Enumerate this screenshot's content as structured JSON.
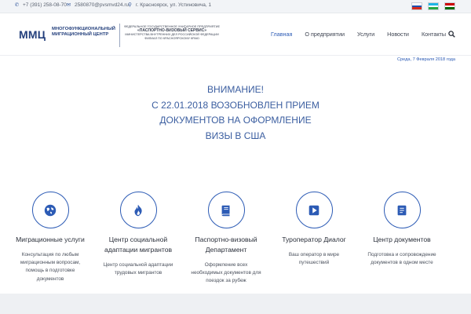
{
  "topbar": {
    "phone": "+7 (391) 258-08-70",
    "email": "2580870@pvsmvd24.ru",
    "address": "г. Красноярск, ул. Устиновича, 1",
    "phone_icon": "phone-icon",
    "email_icon": "envelope-icon",
    "address_icon": "map-pin-icon",
    "flags": [
      {
        "name": "flag-ru",
        "colors": [
          "#ffffff",
          "#1f4fb0",
          "#d52b1e"
        ]
      },
      {
        "name": "flag-uz",
        "colors": [
          "#1eb5e6",
          "#ffffff",
          "#27a844"
        ]
      },
      {
        "name": "flag-tj",
        "colors": [
          "#cc0000",
          "#ffffff",
          "#006600"
        ]
      }
    ]
  },
  "header": {
    "logo_main": "ММЦ",
    "logo_sub": "МНОГОФУНКЦИОНАЛЬНЫЙ МИГРАЦИОННЫЙ ЦЕНТР",
    "org_line1": "ФЕДЕРАЛЬНОЕ ГОСУДАРСТВЕННОЕ УНИТАРНОЕ ПРЕДПРИЯТИЕ",
    "org_line2": "«ПАСПОРТНО-ВИЗОВЫЙ СЕРВИС»",
    "org_line3": "МИНИСТЕРСТВА ВНУТРЕННИХ ДЕЛ РОССИЙСКОЙ ФЕДЕРАЦИИ",
    "org_line4": "ФИЛИАЛ ПО КРАСНОЯРСКОМУ КРАЮ",
    "nav": [
      "Главная",
      "О предприятии",
      "Услуги",
      "Новости",
      "Контакты"
    ],
    "search_icon": "search-icon",
    "date": "Среда, 7 Февраля 2018 года"
  },
  "notice": {
    "line1": "ВНИМАНИЕ!",
    "line2": "С 22.01.2018 ВОЗОБНОВЛЕН ПРИЕМ",
    "line3": "ДОКУМЕНТОВ НА ОФОРМЛЕНИЕ",
    "line4": "ВИЗЫ В США"
  },
  "services": [
    {
      "icon": "globe-icon",
      "title": "Миграционные услуги",
      "desc": "Консультация по любым миграционным вопросам, помощь в подготовке документов"
    },
    {
      "icon": "fire-icon",
      "title": "Центр социальной адаптации мигрантов",
      "desc": "Центр социальной адаптации трудовых мигрантов"
    },
    {
      "icon": "book-icon",
      "title": "Паспортно-визовый Департамент",
      "desc": "Оформление всех необходимых документов для поездок за рубеж"
    },
    {
      "icon": "play-map-icon",
      "title": "Туроператор Диалог",
      "desc": "Ваш оператор в мире путешествий"
    },
    {
      "icon": "document-icon",
      "title": "Центр документов",
      "desc": "Подготовка и сопровождение документов в одном месте"
    }
  ],
  "colors": {
    "accent": "#2c5bb5",
    "brand": "#233f7c",
    "notice": "#3b5ea0"
  }
}
